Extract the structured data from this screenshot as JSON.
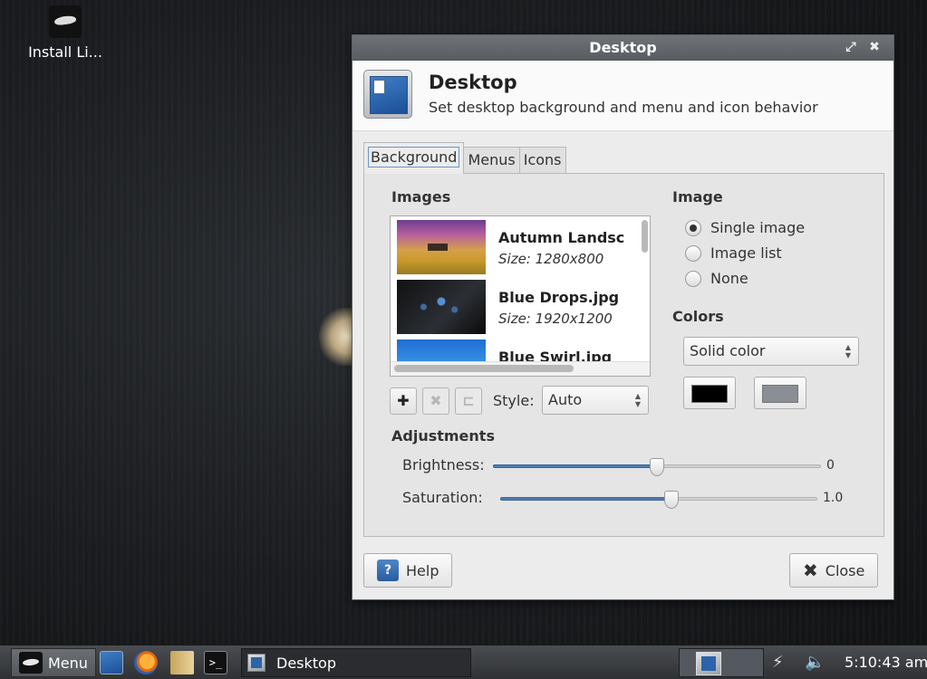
{
  "desktop": {
    "icon_label": "Install Li..."
  },
  "dialog": {
    "window_title": "Desktop",
    "header_title": "Desktop",
    "header_subtitle": "Set desktop background and menu and icon behavior",
    "tabs": [
      {
        "label": "Background",
        "active": true
      },
      {
        "label": "Menus",
        "active": false
      },
      {
        "label": "Icons",
        "active": false
      }
    ],
    "images_title": "Images",
    "images": [
      {
        "name": "Autumn Landsc",
        "size": "Size: 1280x800",
        "thumb": "autumn"
      },
      {
        "name": "Blue Drops.jpg",
        "size": "Size: 1920x1200",
        "thumb": "drops"
      },
      {
        "name": "Blue Swirl.jpg",
        "size": "",
        "thumb": "swirl"
      }
    ],
    "add_icon": "plus-icon",
    "remove_icon": "remove-icon",
    "set_icon": "folder-icon",
    "style_label": "Style:",
    "style_value": "Auto",
    "image_section_title": "Image",
    "image_options": [
      {
        "label": "Single image",
        "selected": true
      },
      {
        "label": "Image list",
        "selected": false
      },
      {
        "label": "None",
        "selected": false
      }
    ],
    "colors_title": "Colors",
    "color_mode": "Solid color",
    "primary_color": "#000000",
    "secondary_color": "#8a8f95",
    "adjustments_title": "Adjustments",
    "brightness_label": "Brightness:",
    "brightness_value": "0",
    "brightness_fraction": 0.5,
    "saturation_label": "Saturation:",
    "saturation_value": "1.0",
    "saturation_fraction": 0.54,
    "help_label": "Help",
    "close_label": "Close"
  },
  "panel": {
    "menu_label": "Menu",
    "task_label": "Desktop",
    "terminal_glyph": ">_",
    "clock": "5:10:43 am"
  },
  "colors": {
    "accent": "#4f7cb3",
    "panel": "#3a3d41"
  }
}
